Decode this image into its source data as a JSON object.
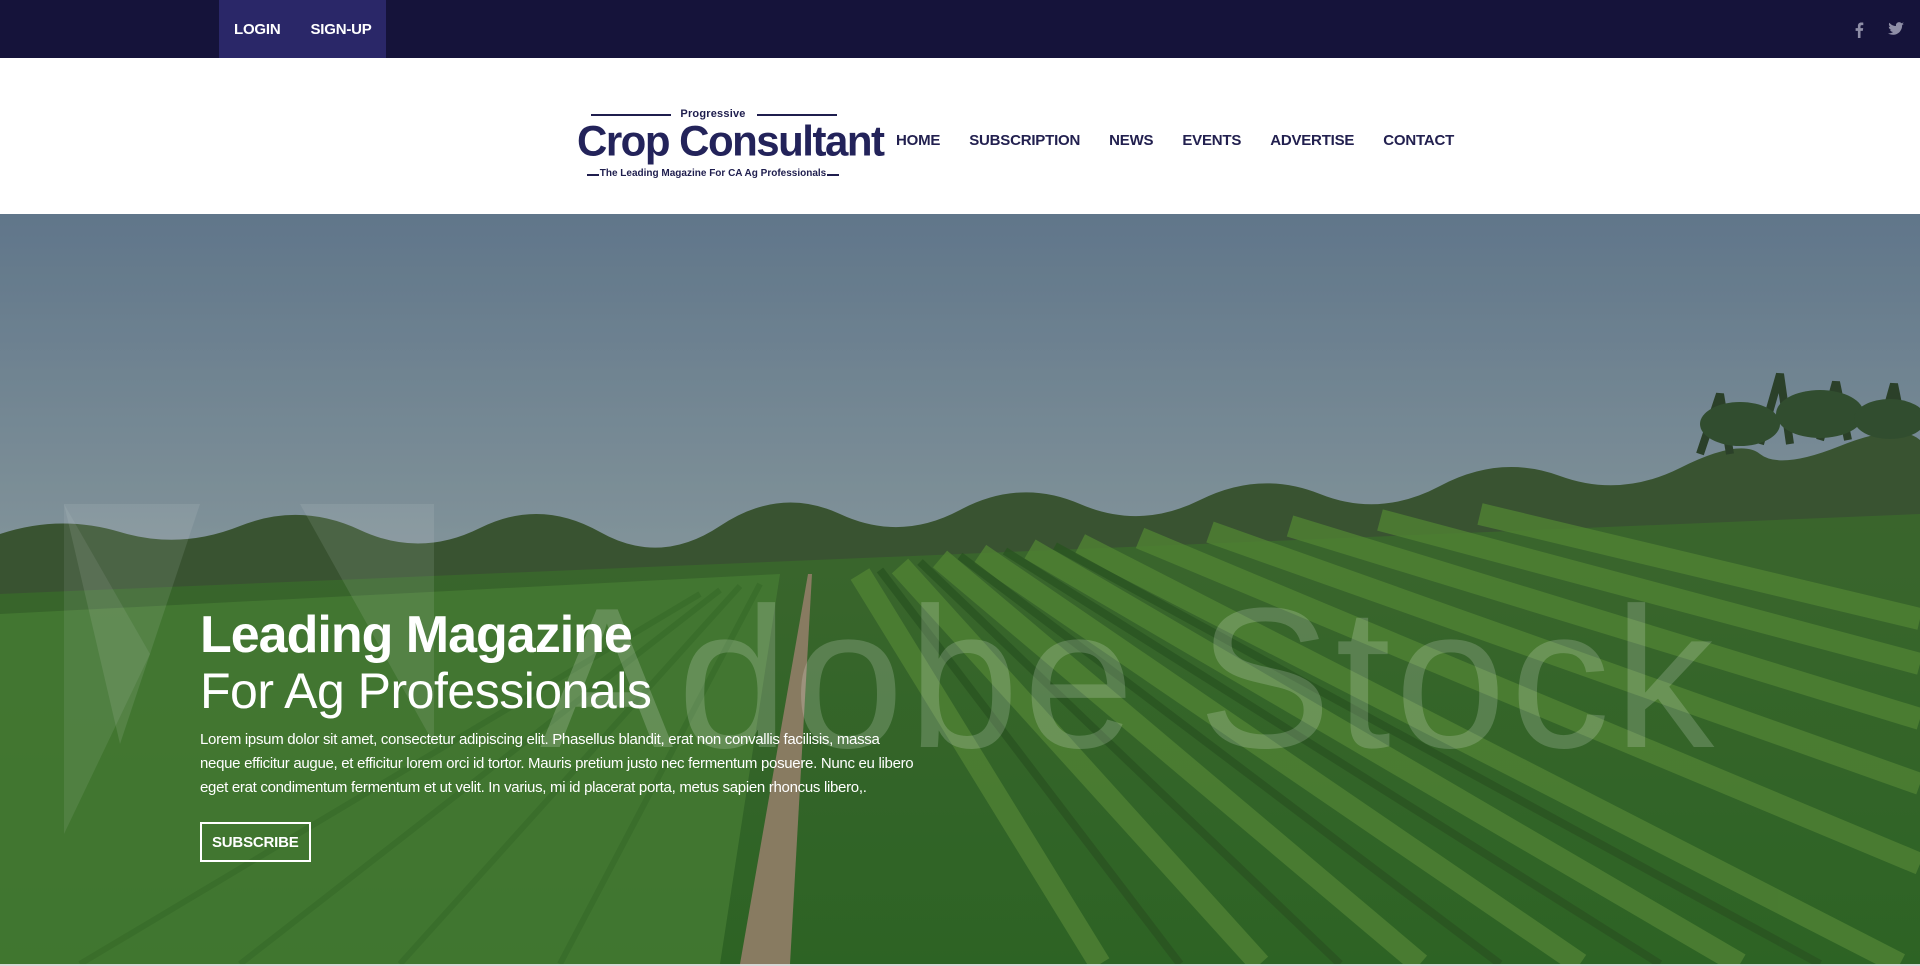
{
  "topbar": {
    "login_label": "LOGIN",
    "signup_label": "SIGN-UP",
    "social_icons": [
      "facebook-icon",
      "twitter-icon"
    ]
  },
  "logo": {
    "overline": "Progressive",
    "name": "Crop Consultant",
    "tagline": "The Leading Magazine For CA Ag Professionals"
  },
  "nav": {
    "items": [
      {
        "label": "HOME"
      },
      {
        "label": "SUBSCRIPTION"
      },
      {
        "label": "NEWS"
      },
      {
        "label": "EVENTS"
      },
      {
        "label": "ADVERTISE"
      },
      {
        "label": "CONTACT"
      }
    ]
  },
  "hero": {
    "title": "Leading Magazine",
    "subtitle": "For Ag Professionals",
    "body": "Lorem ipsum dolor sit amet, consectetur adipiscing elit. Phasellus blandit, erat non convallis facilisis, massa neque efficitur augue, et efficitur lorem orci id tortor. Mauris pretium justo nec fermentum posuere. Nunc eu libero eget erat condimentum fermentum et ut velit. In varius, mi id placerat porta, metus sapien rhoncus libero,.",
    "button_label": "SUBSCRIBE",
    "watermark": "Adobe Stock"
  },
  "colors": {
    "topbar_bg": "#15133a",
    "auth_bg": "#2a2768",
    "brand": "#23235a",
    "nav_text": "#22204f"
  }
}
